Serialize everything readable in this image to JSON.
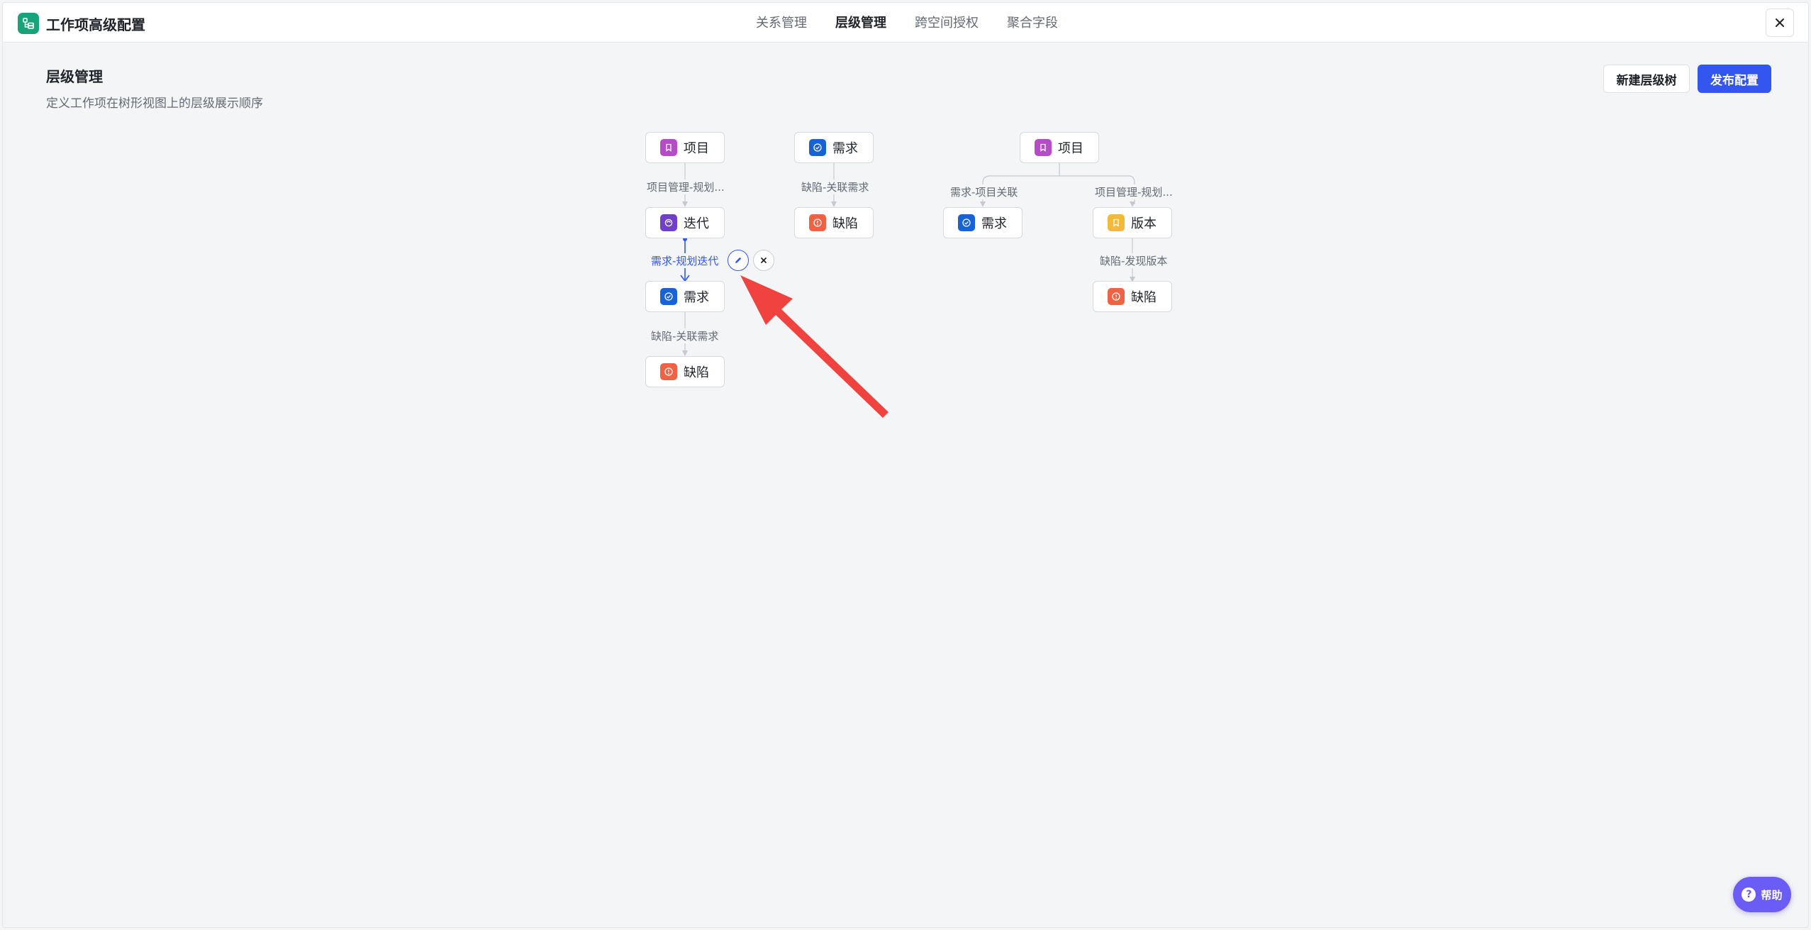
{
  "app": {
    "title": "工作项高级配置",
    "tabs": [
      {
        "label": "关系管理",
        "active": false
      },
      {
        "label": "层级管理",
        "active": true
      },
      {
        "label": "跨空间授权",
        "active": false
      },
      {
        "label": "聚合字段",
        "active": false
      }
    ]
  },
  "page": {
    "title": "层级管理",
    "description": "定义工作项在树形视图上的层级展示顺序",
    "new_tree_button": "新建层级树",
    "publish_button": "发布配置"
  },
  "node_types": {
    "项目": {
      "color": "#b44bc7",
      "icon": "bookmark-icon"
    },
    "迭代": {
      "color": "#7040c9",
      "icon": "iteration-icon"
    },
    "需求": {
      "color": "#1763d6",
      "icon": "check-circle-icon"
    },
    "缺陷": {
      "color": "#ef6243",
      "icon": "alert-circle-icon"
    },
    "版本": {
      "color": "#f2b93b",
      "icon": "bookmark-icon"
    }
  },
  "trees": [
    {
      "nodes": [
        "项目",
        "迭代",
        "需求",
        "缺陷"
      ],
      "edges": [
        "项目管理-规划...",
        "需求-规划迭代",
        "缺陷-关联需求"
      ],
      "selected_edge": "需求-规划迭代"
    },
    {
      "nodes": [
        "需求",
        "缺陷"
      ],
      "edges": [
        "缺陷-关联需求"
      ]
    },
    {
      "root": "项目",
      "children": [
        "需求",
        "版本"
      ],
      "grandchild": "缺陷",
      "edges": [
        "需求-项目关联",
        "项目管理-规划...",
        "缺陷-发现版本"
      ]
    }
  ],
  "edge_actions": {
    "edit_icon": "pencil-icon",
    "delete_icon": "close-icon"
  },
  "help": {
    "label": "帮助",
    "icon": "question-icon"
  },
  "accent_color": "#3355f0",
  "annotation": {
    "type": "red-arrow",
    "color": "#f0423f"
  }
}
